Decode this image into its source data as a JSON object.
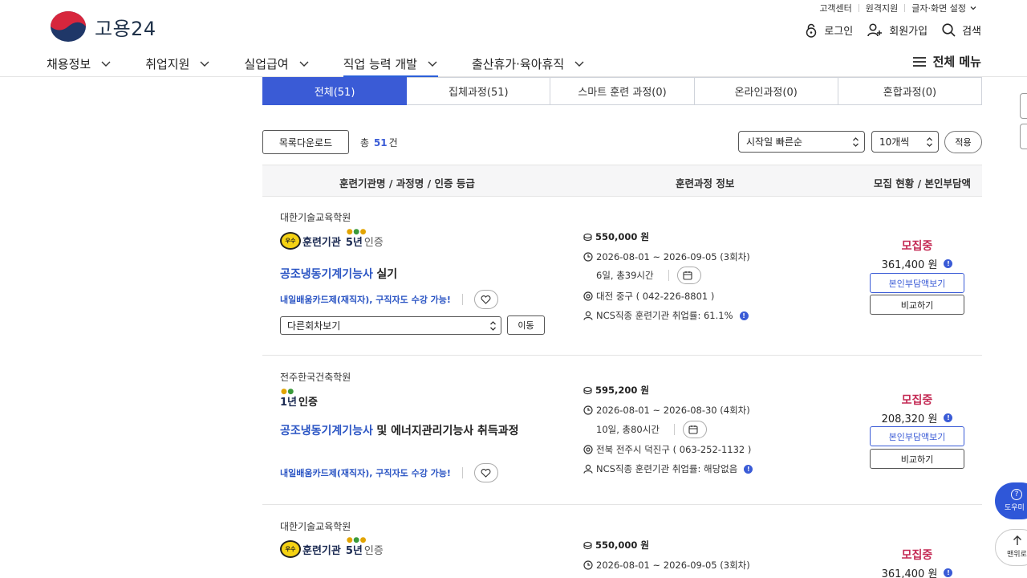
{
  "header": {
    "logo_text": "고용24",
    "util": [
      "고객센터",
      "원격지원",
      "글자·화면 설정"
    ],
    "login": "로그인",
    "signup": "회원가입",
    "search": "검색",
    "gnb": [
      "채용정보",
      "취업지원",
      "실업급여",
      "직업 능력 개발",
      "출산휴가·육아휴직"
    ],
    "gnb_active": "직업 능력 개발",
    "all_menu": "전체 메뉴"
  },
  "tabs": [
    "전체(51)",
    "집체과정(51)",
    "스마트 훈련 과정(0)",
    "온라인과정(0)",
    "혼합과정(0)"
  ],
  "toolbar": {
    "download": "목록다운로드",
    "total_prefix": "총",
    "total_count": "51",
    "total_suffix": "건",
    "sort_value": "시작일 빠른순",
    "count_value": "10개씩",
    "apply": "적용"
  },
  "table_headers": [
    "훈련기관명 / 과정명 / 인증 등급",
    "훈련과정 정보",
    "모집 현황 / 본인부담액"
  ],
  "courses": [
    {
      "institution": "대한기술교육학원",
      "badge_text": "우수",
      "cert_org": "훈련기관",
      "cert_year": "5년",
      "cert_label": "인증",
      "title_link": "공조냉동기계기능사",
      "title_rest": "실기",
      "tag_card": "내일배움카드제(재직자)",
      "tag_sep": ",",
      "tag_extra": "구직자도 수강 가능!",
      "round_select": "다른회차보기",
      "move": "이동",
      "price": "550,000 원",
      "period": "2026-08-01 ~ 2026-09-05 (3회차)",
      "duration": "6일, 총39시간",
      "location": "대전 중구 ( 042-226-8801 )",
      "ncs": "NCS직종 훈련기관 취업률: 61.1%",
      "status": "모집중",
      "self_pay": "361,400 원",
      "burden_btn": "본인부담액보기",
      "compare_btn": "비교하기"
    },
    {
      "institution": "전주한국건축학원",
      "cert_year": "1년",
      "cert_label": "인증",
      "title_link": "공조냉동기계기능사",
      "title_rest": "및 에너지관리기능사 취득과정",
      "tag_card": "내일배움카드제(재직자)",
      "tag_sep": ",",
      "tag_extra": "구직자도 수강 가능!",
      "price": "595,200 원",
      "period": "2026-08-01 ~ 2026-08-30 (4회차)",
      "duration": "10일, 총80시간",
      "location": "전북 전주시 덕진구 ( 063-252-1132 )",
      "ncs": "NCS직종 훈련기관 취업률: 해당없음",
      "status": "모집중",
      "self_pay": "208,320 원",
      "burden_btn": "본인부담액보기",
      "compare_btn": "비교하기"
    },
    {
      "institution": "대한기술교육학원",
      "badge_text": "우수",
      "cert_org": "훈련기관",
      "cert_year": "5년",
      "cert_label": "인증",
      "price": "550,000 원",
      "period": "2026-08-01 ~ 2026-09-05 (3회차)",
      "status": "모집중",
      "self_pay": "361,400 원"
    }
  ],
  "float": {
    "help": "도우미",
    "top": "맨위로"
  }
}
